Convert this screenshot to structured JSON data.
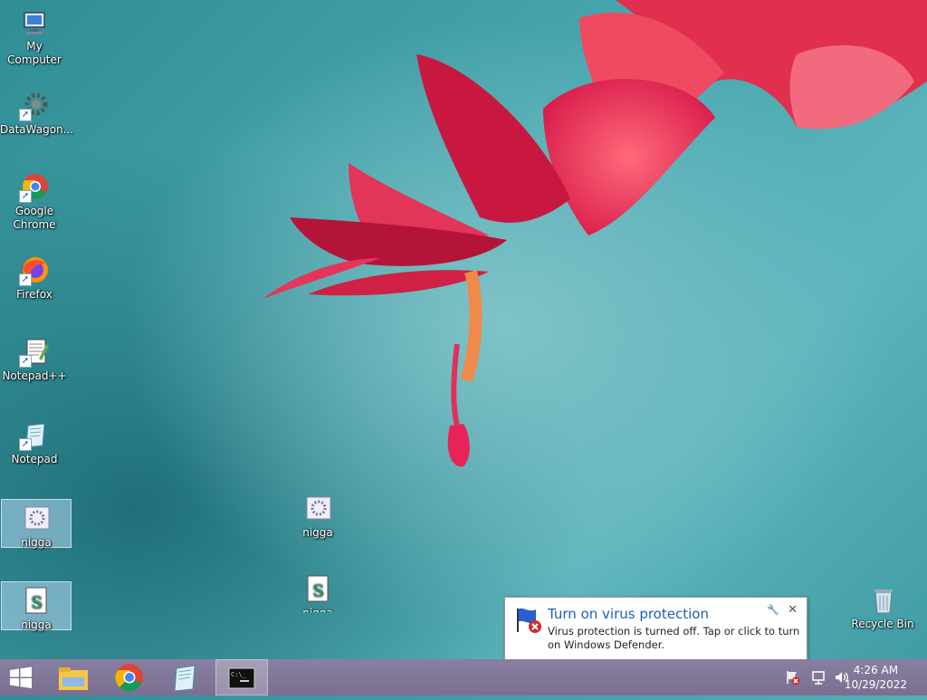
{
  "desktop": {
    "icons": [
      {
        "label": "My Computer"
      },
      {
        "label": "DataWagon..."
      },
      {
        "label": "Google Chrome"
      },
      {
        "label": "Firefox"
      },
      {
        "label": "Notepad++"
      },
      {
        "label": "Notepad"
      },
      {
        "label": "nigga"
      },
      {
        "label": "nigga"
      },
      {
        "label": "nigga"
      },
      {
        "label": "nigga"
      },
      {
        "label": "Recycle Bin"
      }
    ]
  },
  "notification": {
    "title": "Turn on virus protection",
    "body": "Virus protection is turned off. Tap or click to turn on Windows Defender.",
    "close": "✕"
  },
  "taskbar": {
    "pinned": [
      {
        "icon": "start-icon"
      },
      {
        "icon": "file-explorer-icon"
      },
      {
        "icon": "chrome-icon"
      },
      {
        "icon": "notepad-icon"
      },
      {
        "icon": "command-prompt-icon",
        "active": true
      }
    ],
    "tray": {
      "time": "4:26 AM",
      "date": "10/29/2022"
    }
  },
  "colors": {
    "accent": "#1a5fb4",
    "taskbar": "#7a6f92",
    "wallpaper": "#4aa8b0"
  }
}
